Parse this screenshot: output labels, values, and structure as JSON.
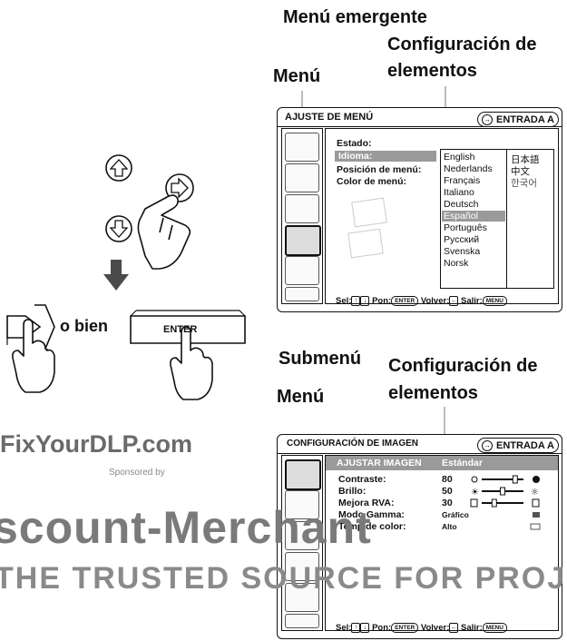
{
  "labels": {
    "popup_menu": "Menú emergente",
    "config_items_1_line1": "Configuración de",
    "config_items_1_line2": "elementos",
    "menu_1": "Menú",
    "submenu": "Submenú",
    "config_items_2_line1": "Configuración de",
    "config_items_2_line2": "elementos",
    "menu_2": "Menú",
    "o_bien": "o bien",
    "enter_key": "ENTER"
  },
  "screen1": {
    "title": "AJUSTE DE MENÚ",
    "enter_label": "ENTRADA A",
    "items": [
      {
        "label": "Estado:"
      },
      {
        "label": "Idioma:"
      },
      {
        "label": "Posición de menú:"
      },
      {
        "label": "Color de menú:"
      }
    ],
    "languages_col1": [
      "English",
      "Nederlands",
      "Français",
      "Italiano",
      "Deutsch",
      "Español",
      "Português",
      "Pyccкий",
      "Svenska",
      "Norsk"
    ],
    "languages_col2": [
      "日本語",
      "中文",
      "한국어"
    ],
    "selected_language": "Español",
    "footer": {
      "sel": "Sel:",
      "pon": "Pon:",
      "pon_key": "ENTER",
      "volver": "Volver:",
      "salir": "Salir:",
      "salir_key": "MENU"
    }
  },
  "screen2": {
    "title": "CONFIGURACIÓN DE IMAGEN",
    "enter_label": "ENTRADA A",
    "header_item": "AJUSTAR IMAGEN",
    "header_value": "Estándar",
    "rows": [
      {
        "label": "Contraste:",
        "value": "80",
        "level": 0.8
      },
      {
        "label": "Brillo:",
        "value": "50",
        "level": 0.5
      },
      {
        "label": "Mejora RVA:",
        "value": "30",
        "level": 0.3
      },
      {
        "label": "Modo Gamma:",
        "value": "Gráfico"
      },
      {
        "label": "Temp de color:",
        "value": "Alto"
      }
    ],
    "footer": {
      "sel": "Sel:",
      "pon": "Pon:",
      "pon_key": "ENTER",
      "volver": "Volver:",
      "salir": "Salir:",
      "salir_key": "MENU"
    }
  },
  "watermark": {
    "site": "FixYourDLP.com",
    "sponsor": "Sponsored by",
    "brand_line": "scount-Merchant",
    "tagline": "THE TRUSTED SOURCE FOR PROJ"
  },
  "colors": {
    "highlight": "#9a9a9a",
    "watermark": "#7a7a7a",
    "outline": "#111111"
  }
}
